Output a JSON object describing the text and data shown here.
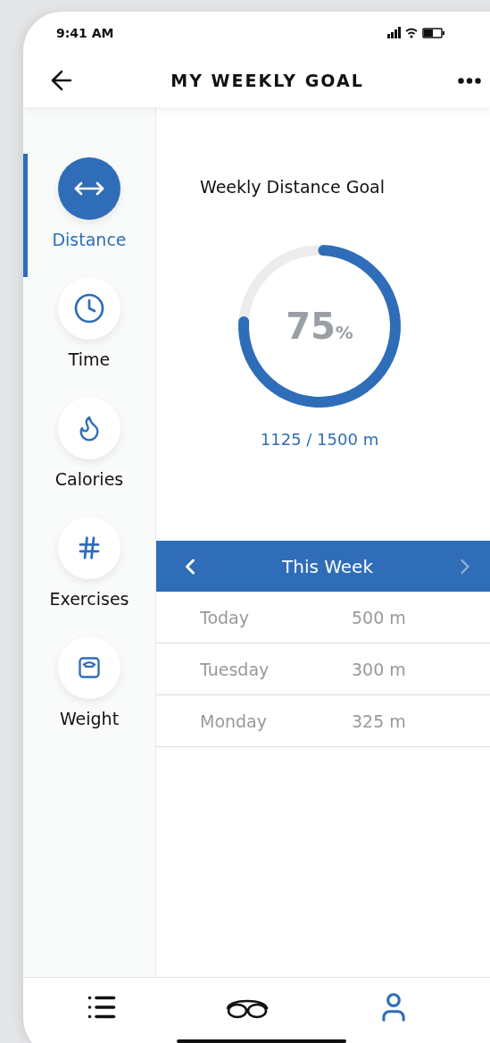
{
  "status_bar": {
    "time": "9:41 AM"
  },
  "header": {
    "title": "MY WEEKLY GOAL"
  },
  "sidebar": {
    "items": [
      {
        "kind": "distance",
        "label": "Distance",
        "selected": true
      },
      {
        "kind": "time",
        "label": "Time",
        "selected": false
      },
      {
        "kind": "calories",
        "label": "Calories",
        "selected": false
      },
      {
        "kind": "exercises",
        "label": "Exercises",
        "selected": false
      },
      {
        "kind": "weight",
        "label": "Weight",
        "selected": false
      }
    ]
  },
  "goal": {
    "title": "Weekly Distance Goal",
    "percent_value": "75",
    "percent_unit": "%",
    "reading": "1125 / 1500 m"
  },
  "week_nav": {
    "label": "This Week",
    "next_disabled": true
  },
  "days": [
    {
      "day": "Today",
      "distance": "500 m"
    },
    {
      "day": "Tuesday",
      "distance": "300 m"
    },
    {
      "day": "Monday",
      "distance": "325 m"
    }
  ],
  "bottom_nav": [
    {
      "kind": "list",
      "selected": false
    },
    {
      "kind": "goggles",
      "selected": false
    },
    {
      "kind": "profile",
      "selected": true
    }
  ]
}
